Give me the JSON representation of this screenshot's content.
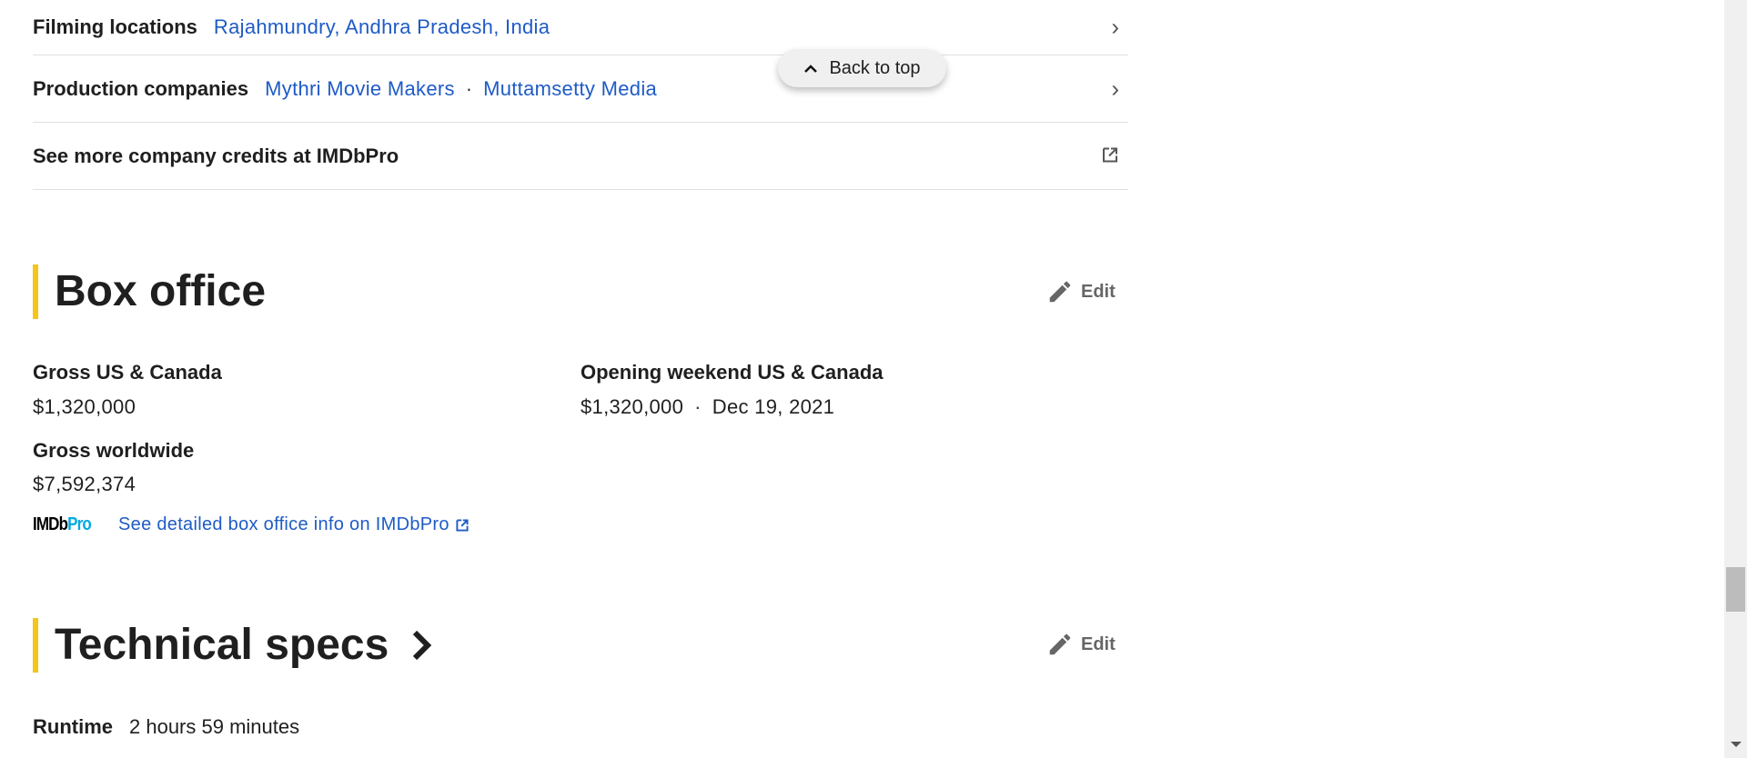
{
  "details": {
    "filming": {
      "label": "Filming locations",
      "value": "Rajahmundry, Andhra Pradesh, India"
    },
    "production": {
      "label": "Production companies",
      "companies": [
        "Mythri Movie Makers",
        "Muttamsetty Media"
      ],
      "separator": "·"
    },
    "more_credits": "See more company credits at IMDbPro"
  },
  "back_to_top": "Back to top",
  "box_office": {
    "title": "Box office",
    "edit": "Edit",
    "gross_us_label": "Gross US & Canada",
    "gross_us": "$1,320,000",
    "gross_world_label": "Gross worldwide",
    "gross_world": "$7,592,374",
    "opening_label": "Opening weekend US & Canada",
    "opening_value": "$1,320,000",
    "opening_date": "Dec 19, 2021",
    "separator": "·",
    "pro_logo_a": "IMDb",
    "pro_logo_b": "Pro",
    "pro_link": "See detailed box office info on IMDbPro"
  },
  "tech": {
    "title": "Technical specs",
    "edit": "Edit",
    "runtime_label": "Runtime",
    "runtime": "2 hours 59 minutes"
  }
}
